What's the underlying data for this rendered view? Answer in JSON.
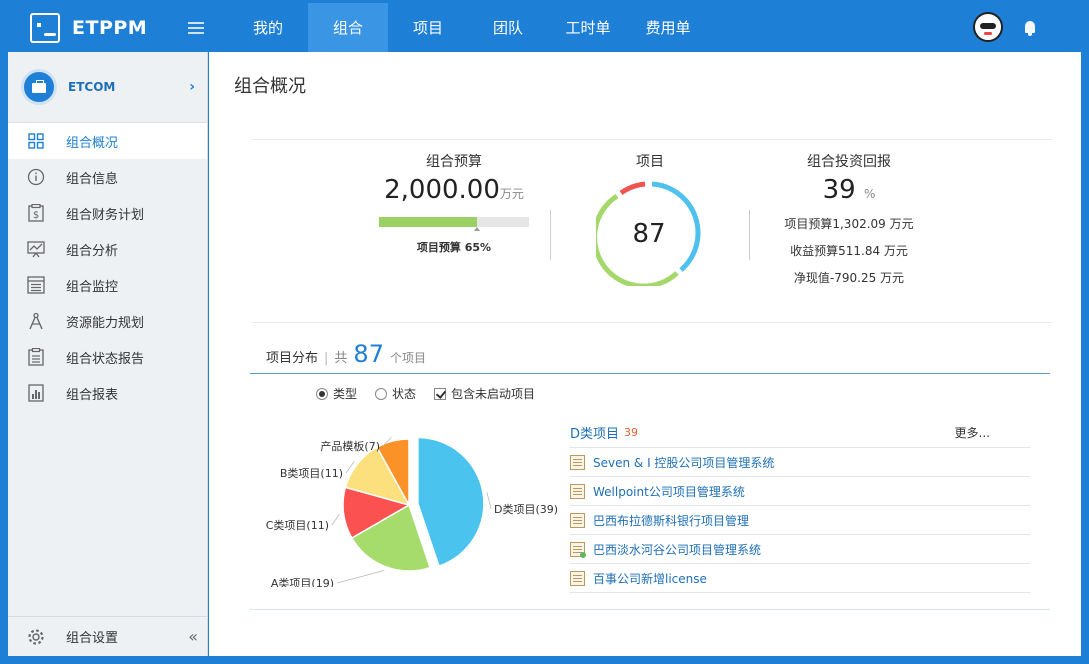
{
  "app": {
    "name": "ETPPM"
  },
  "nav": [
    {
      "label": "我的"
    },
    {
      "label": "组合",
      "active": true
    },
    {
      "label": "项目"
    },
    {
      "label": "团队"
    },
    {
      "label": "工时单"
    },
    {
      "label": "费用单"
    }
  ],
  "sidebar": {
    "org_name": "ETCOM",
    "items": [
      {
        "label": "组合概况",
        "icon": "grid-icon",
        "active": true
      },
      {
        "label": "组合信息",
        "icon": "info-icon"
      },
      {
        "label": "组合财务计划",
        "icon": "finance-icon"
      },
      {
        "label": "组合分析",
        "icon": "analysis-icon"
      },
      {
        "label": "组合监控",
        "icon": "monitor-icon"
      },
      {
        "label": "资源能力规划",
        "icon": "compass-icon"
      },
      {
        "label": "组合状态报告",
        "icon": "report-icon"
      },
      {
        "label": "组合报表",
        "icon": "chart-icon"
      }
    ],
    "settings_label": "组合设置"
  },
  "main": {
    "title": "组合概况",
    "budget": {
      "title": "组合预算",
      "value": "2,000.00",
      "unit": "万元",
      "progress": 0.65,
      "label": "项目预算 65%"
    },
    "projects": {
      "title": "项目",
      "count": "87"
    },
    "roi": {
      "title": "组合投资回报",
      "value": "39",
      "unit": "%",
      "lines": [
        "项目预算1,302.09 万元",
        "收益预算511.84 万元",
        "净现值-790.25 万元"
      ]
    },
    "distribution": {
      "title": "项目分布",
      "sep": "|",
      "prefix": "共",
      "count": "87",
      "unit": "个项目"
    },
    "filters": [
      {
        "type": "radio",
        "label": "类型",
        "checked": true
      },
      {
        "type": "radio",
        "label": "状态",
        "checked": false
      },
      {
        "type": "checkbox",
        "label": "包含未启动项目",
        "checked": true
      }
    ],
    "list": {
      "title": "D类项目",
      "count": "39",
      "more": "更多...",
      "rows": [
        {
          "name": "Seven & I 控股公司项目管理系统",
          "icon": "project-doc-icon"
        },
        {
          "name": "Wellpoint公司项目管理系统",
          "icon": "project-doc-icon"
        },
        {
          "name": "巴西布拉德斯科银行项目管理",
          "icon": "project-doc-icon"
        },
        {
          "name": "巴西淡水河谷公司项目管理系统",
          "icon": "project-doc-active-icon"
        },
        {
          "name": "百事公司新增license",
          "icon": "project-doc-icon"
        }
      ]
    }
  },
  "colors": {
    "brand": "#1e7fd6",
    "ring_blue": "#4fc1ee",
    "ring_green": "#a5d86a",
    "ring_red": "#f0544f"
  },
  "chart_data": {
    "type": "pie",
    "slices": [
      {
        "label": "D类项目(39)",
        "value": 39,
        "color": "#4ac3ef"
      },
      {
        "label": "A类项目(19)",
        "value": 19,
        "color": "#a5dc6b"
      },
      {
        "label": "C类项目(11)",
        "value": 11,
        "color": "#fb5150"
      },
      {
        "label": "B类项目(11)",
        "value": 11,
        "color": "#fbe07d"
      },
      {
        "label": "产品模板(7)",
        "value": 7,
        "color": "#fb9227"
      }
    ],
    "exploded": "D类项目(39)"
  }
}
